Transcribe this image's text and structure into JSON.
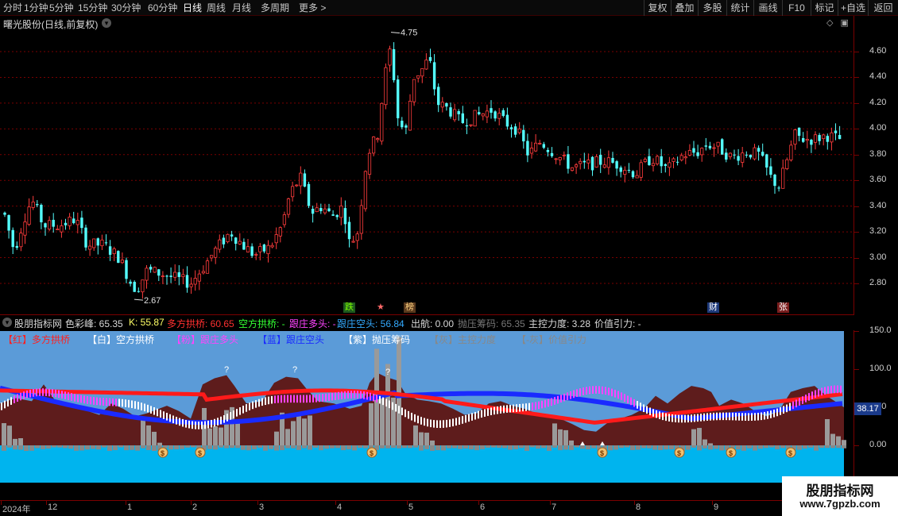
{
  "toolbar": {
    "periods": [
      "分时",
      "1分钟",
      "5分钟",
      "15分钟",
      "30分钟",
      "60分钟",
      "日线",
      "周线",
      "月线",
      "多周期",
      "更多 >"
    ],
    "active_period": "日线",
    "buttons": [
      "复权",
      "叠加",
      "多股",
      "统计",
      "画线",
      "F10",
      "标记",
      "+自选",
      "返回"
    ]
  },
  "main_chart": {
    "title": "曙光股份(日线,前复权)",
    "y_ticks": [
      "4.60",
      "4.40",
      "4.20",
      "4.00",
      "3.80",
      "3.60",
      "3.40",
      "3.20",
      "3.00",
      "2.80"
    ],
    "high_label": "4.75",
    "low_label": "2.67",
    "markers": [
      {
        "text": "跌",
        "color": "#7CFC00",
        "bg": "#1e5a1e"
      },
      {
        "text": "★",
        "color": "#ff6a6a",
        "bg": "#000"
      },
      {
        "text": "榜",
        "color": "#ffd27f",
        "bg": "#5a3a1e"
      },
      {
        "text": "财",
        "color": "#ffffff",
        "bg": "#1e3a7a"
      },
      {
        "text": "张",
        "color": "#ffffff",
        "bg": "#7a1e1e"
      }
    ]
  },
  "indicator_bar": {
    "name": "股朋指标网",
    "items": [
      {
        "label": "色彩峰: 65.35",
        "color": "#d8d8d8"
      },
      {
        "label": "K: 55.87",
        "color": "#ffff66"
      },
      {
        "label": "多方拱桥: 60.65",
        "color": "#ff3030"
      },
      {
        "label": "空方拱桥: -",
        "color": "#33ff33"
      },
      {
        "label": "跟庄多头: -",
        "color": "#ff44ff"
      },
      {
        "label": "跟庄空头: 56.84",
        "color": "#33aaff"
      },
      {
        "label": "出航: 0.00",
        "color": "#d8d8d8"
      },
      {
        "label": "抛压筹码: 65.35",
        "color": "#777777"
      },
      {
        "label": "主控力度: 3.28",
        "color": "#d8d8d8"
      },
      {
        "label": "价值引力: -",
        "color": "#d8d8d8"
      }
    ]
  },
  "sub_legend": [
    {
      "text": "【红】多方拱桥",
      "color": "#ff2020"
    },
    {
      "text": "【白】空方拱桥",
      "color": "#ffffff"
    },
    {
      "text": "【粉】跟庄多头",
      "color": "#ff44ff"
    },
    {
      "text": "【蓝】跟庄空头",
      "color": "#1a2aff"
    },
    {
      "text": "【紫】抛压筹码",
      "color": "#ffffff"
    },
    {
      "text": "【灰】主控力度",
      "color": "#888888"
    },
    {
      "text": "【-灰】价值引力",
      "color": "#888888"
    }
  ],
  "sub_chart": {
    "y_ticks": [
      "150.0",
      "100.0",
      "50.0",
      "0.00"
    ],
    "current_value": "38.17",
    "question_mark": "?",
    "money_icon": "$"
  },
  "date_axis": [
    "2024年",
    "12",
    "1",
    "2",
    "3",
    "4",
    "5",
    "6",
    "7",
    "8",
    "9"
  ],
  "watermark": {
    "line1": "股朋指标网",
    "line2": "www.7gpzb.com"
  },
  "colors": {
    "up": "#ff3d3d",
    "down": "#54ffff",
    "grid": "#7a0000",
    "sub_bg": "#5b9bd8",
    "cyan": "#00b4ee"
  }
}
